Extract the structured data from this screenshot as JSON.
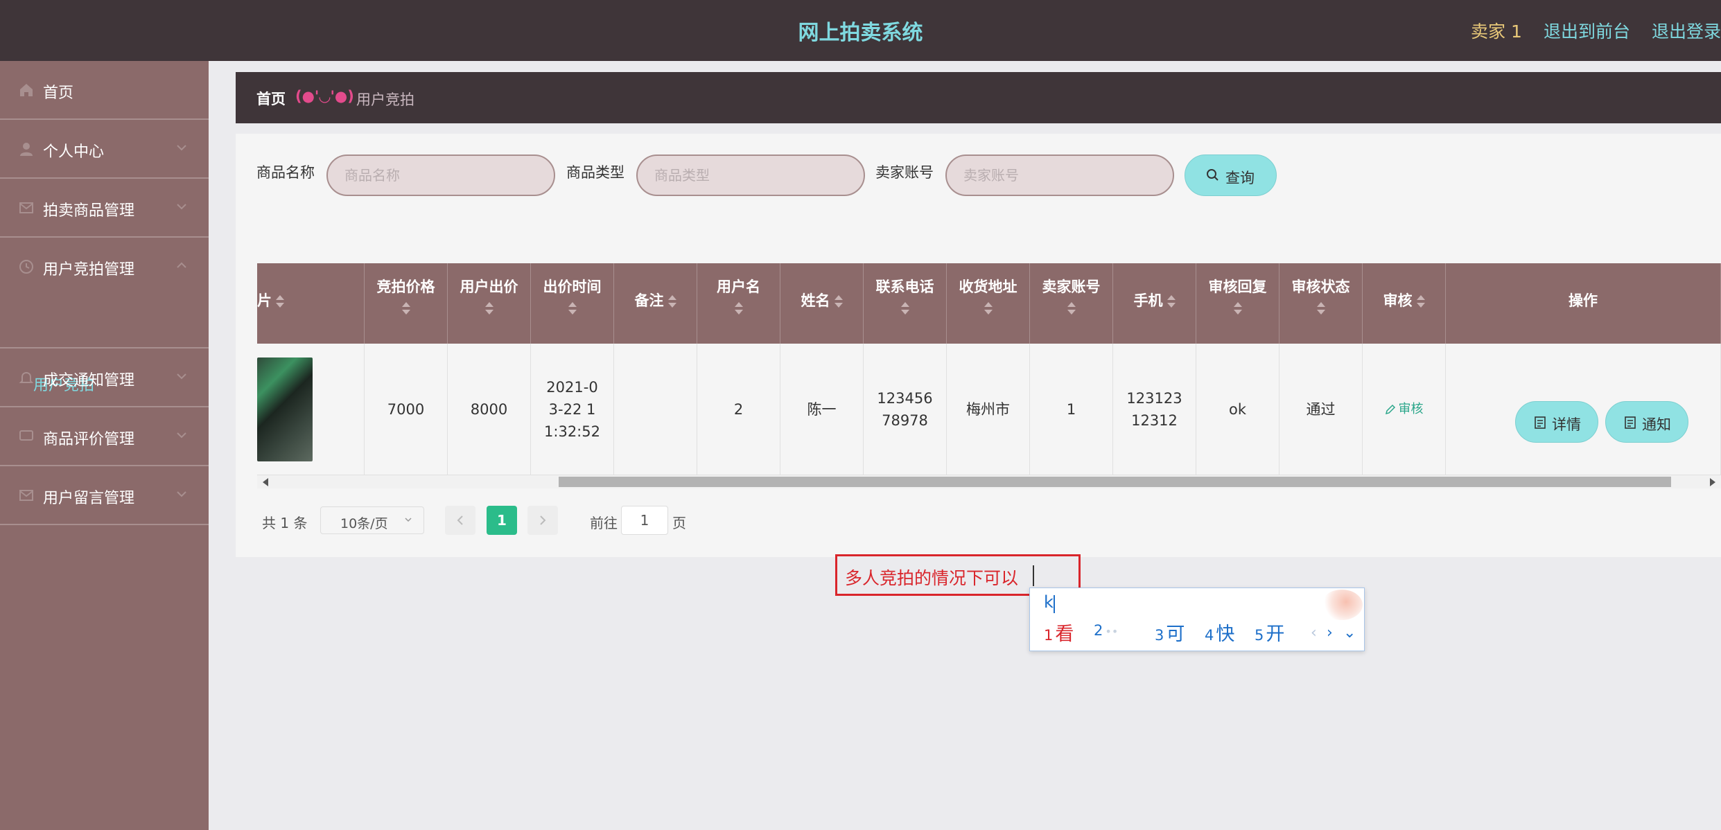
{
  "header": {
    "title": "网上拍卖系统",
    "user": "卖家 1",
    "link_front": "退出到前台",
    "link_logout": "退出登录"
  },
  "sidebar": {
    "items": [
      {
        "label": "首页",
        "icon": "home-icon"
      },
      {
        "label": "个人中心",
        "icon": "user-icon"
      },
      {
        "label": "拍卖商品管理",
        "icon": "mail-icon"
      },
      {
        "label": "用户竞拍管理",
        "icon": "clock-icon"
      },
      {
        "label": "成交通知管理",
        "icon": "bell-icon"
      },
      {
        "label": "商品评价管理",
        "icon": "chat-icon"
      },
      {
        "label": "用户留言管理",
        "icon": "message-icon"
      }
    ],
    "sub_item": "用户竞拍"
  },
  "breadcrumb": {
    "home": "首页",
    "emoji": "(●'◡'●)",
    "current": "用户竞拍"
  },
  "search": {
    "product_name_label": "商品名称",
    "product_name_placeholder": "商品名称",
    "product_type_label": "商品类型",
    "product_type_placeholder": "商品类型",
    "seller_label": "卖家账号",
    "seller_placeholder": "卖家账号",
    "button": "查询"
  },
  "table": {
    "headers": {
      "img_partial": "片",
      "price": "竞拍价格",
      "bid": "用户出价",
      "bid_time": "出价时间",
      "note": "备注",
      "username": "用户名",
      "name": "姓名",
      "phone": "联系电话",
      "address": "收货地址",
      "seller": "卖家账号",
      "mobile": "手机",
      "reply": "审核回复",
      "status": "审核状态",
      "audit": "审核",
      "action": "操作"
    },
    "row": {
      "price": "7000",
      "bid": "8000",
      "bid_time": "2021-03-22 11:32:52",
      "note": "",
      "username": "2",
      "name": "陈一",
      "phone": "12345678978",
      "address": "梅州市",
      "seller": "1",
      "mobile": "12312312312",
      "reply": "ok",
      "status": "通过",
      "audit_link": "审核",
      "detail_btn": "详情",
      "notify_btn": "通知"
    }
  },
  "pagination": {
    "total": "共 1 条",
    "page_size": "10条/页",
    "current": "1",
    "goto_label": "前往",
    "goto_value": "1",
    "page_suffix": "页"
  },
  "note_input": {
    "text": "多人竞拍的情况下可以"
  },
  "ime": {
    "composition": "k",
    "candidates": [
      {
        "num": "1",
        "text": "看"
      },
      {
        "num": "2",
        "text": "••"
      },
      {
        "num": "3",
        "text": "可"
      },
      {
        "num": "4",
        "text": "快"
      },
      {
        "num": "5",
        "text": "开"
      }
    ],
    "nav_prev": "‹",
    "nav_next": "›",
    "nav_expand": "⌄"
  },
  "colors": {
    "topbar": "#3f3539",
    "sidebar": "#8b6a6a",
    "accent_cyan": "#7fd9e0",
    "button_cyan": "#90e2e3",
    "pagination_active": "#2bbc8a",
    "note_border": "#d9252b"
  }
}
